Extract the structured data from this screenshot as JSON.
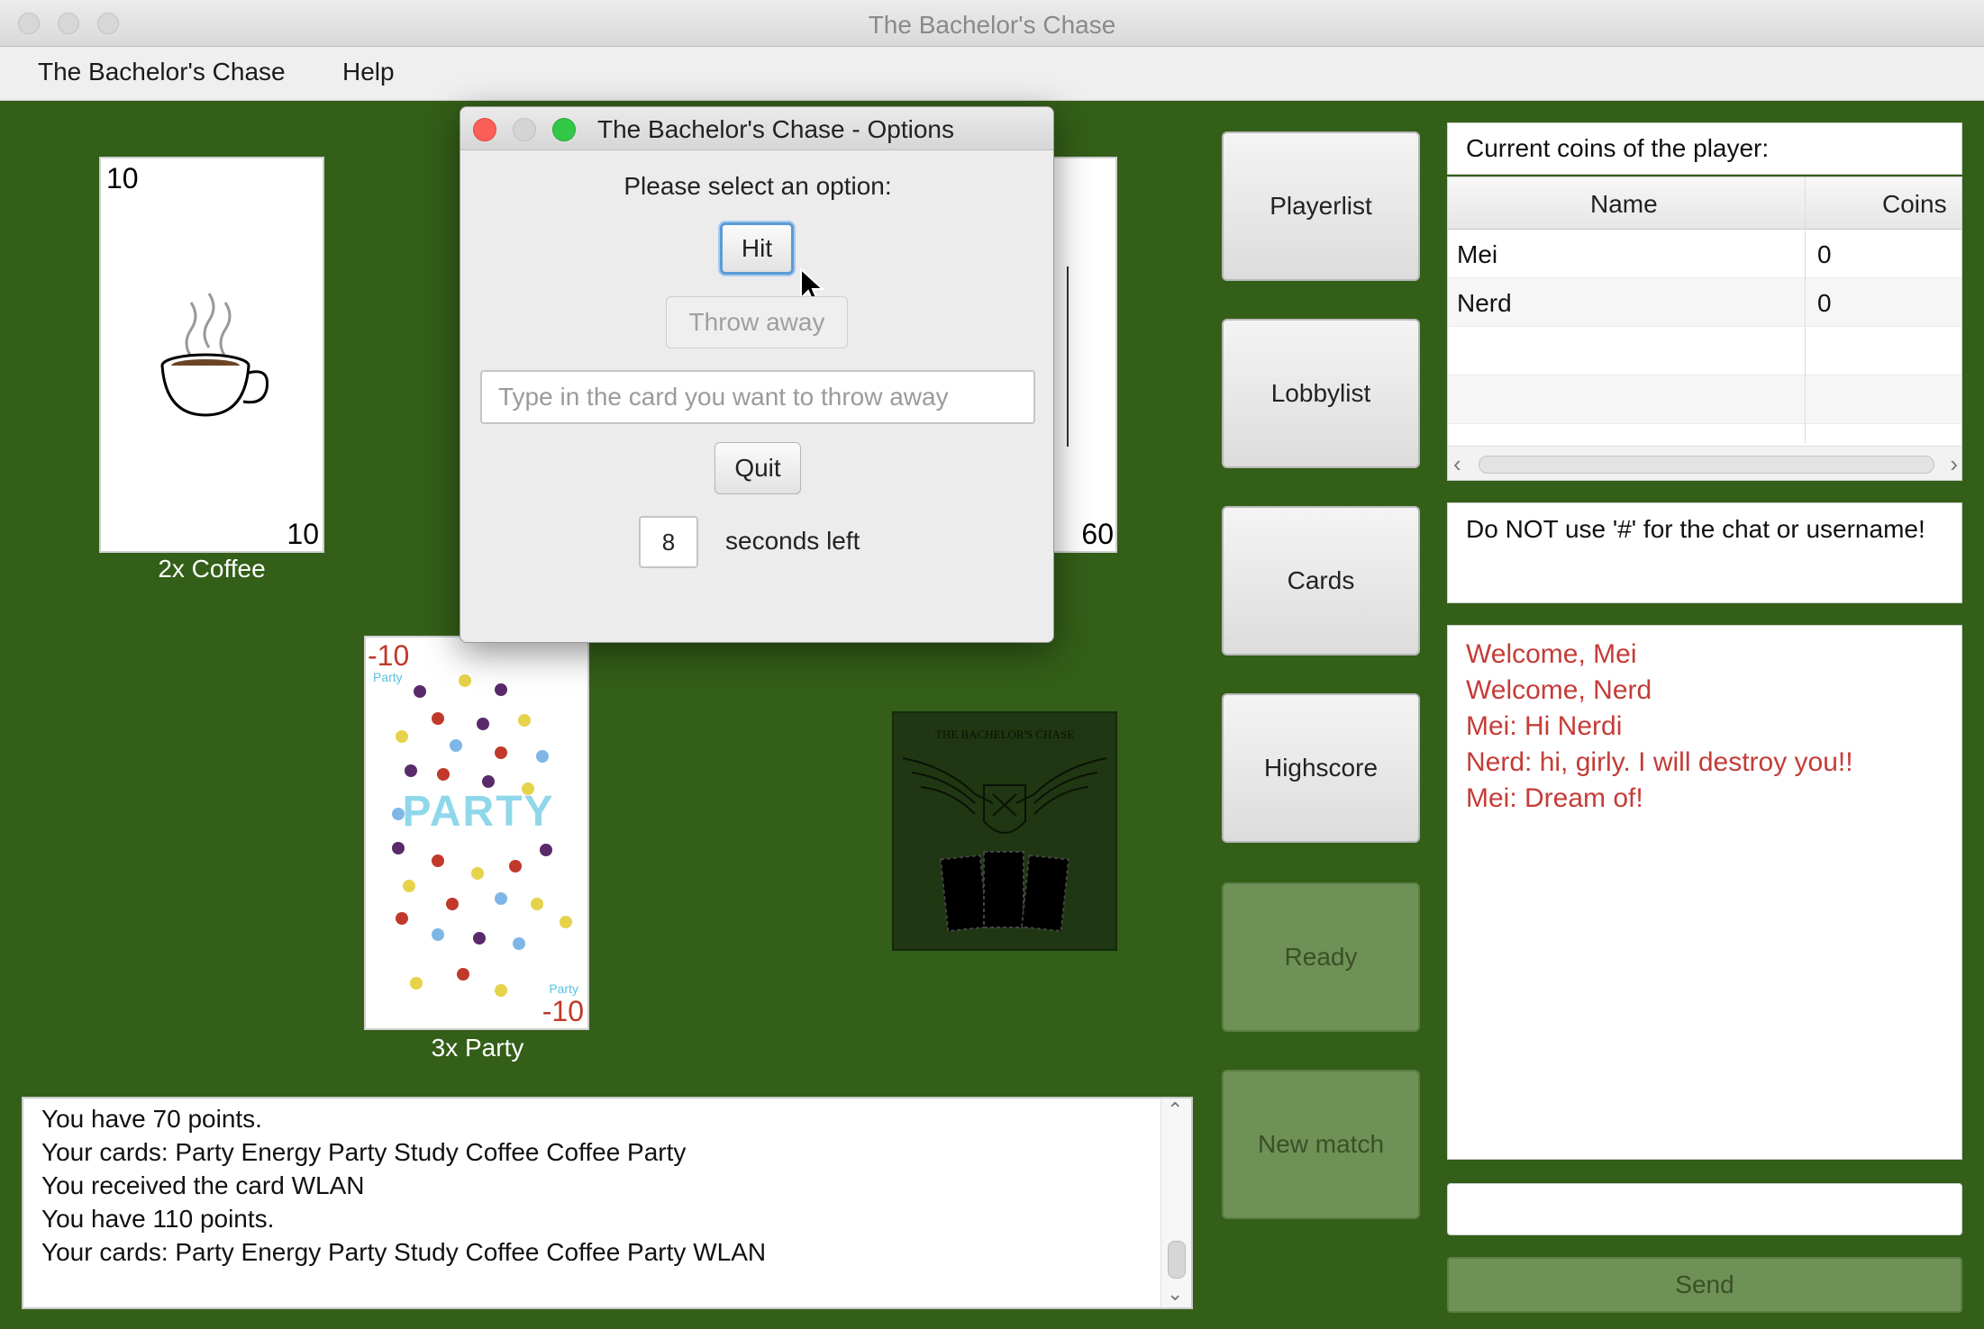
{
  "window": {
    "title": "The Bachelor's Chase"
  },
  "menu": {
    "items": [
      "The Bachelor's Chase",
      "Help"
    ]
  },
  "cards": {
    "coffee": {
      "corner": "10",
      "label": "2x Coffee"
    },
    "party": {
      "corner": "-10",
      "center_text": "PARTY",
      "mini_text": "Party",
      "label": "3x Party"
    },
    "hidden": {
      "corner": "60"
    },
    "deck": {
      "title": "THE BACHELOR'S CHASE"
    }
  },
  "side_buttons": [
    "Playerlist",
    "Lobbylist",
    "Cards",
    "Highscore",
    "Ready",
    "New match"
  ],
  "coins": {
    "header": "Current coins of the player:",
    "columns": [
      "Name",
      "Coins"
    ],
    "rows": [
      {
        "name": "Mei",
        "coins": "0"
      },
      {
        "name": "Nerd",
        "coins": "0"
      }
    ]
  },
  "warning": "Do NOT use '#' for the chat or username!",
  "chat": {
    "messages": [
      "Welcome, Mei",
      "Welcome, Nerd",
      "Mei: Hi Nerdi",
      "Nerd: hi, girly. I will destroy you!!",
      "Mei: Dream of!"
    ],
    "send_label": "Send"
  },
  "log": {
    "lines": [
      "You have 70 points.",
      "Your cards: Party Energy Party Study Coffee Coffee Party",
      "You received the card WLAN",
      "You have 110 points.",
      "Your cards: Party Energy Party Study Coffee Coffee Party WLAN"
    ]
  },
  "dialog": {
    "title": "The Bachelor's Chase - Options",
    "prompt": "Please select an option:",
    "hit_label": "Hit",
    "throw_label": "Throw away",
    "input_placeholder": "Type in the card you want to throw away",
    "quit_label": "Quit",
    "seconds_value": "8",
    "seconds_label": "seconds left"
  },
  "colors": {
    "table": "#335f18",
    "chat_text": "#c43c38",
    "disabled_button": "#6e9156",
    "focus": "#5b9bd5"
  }
}
